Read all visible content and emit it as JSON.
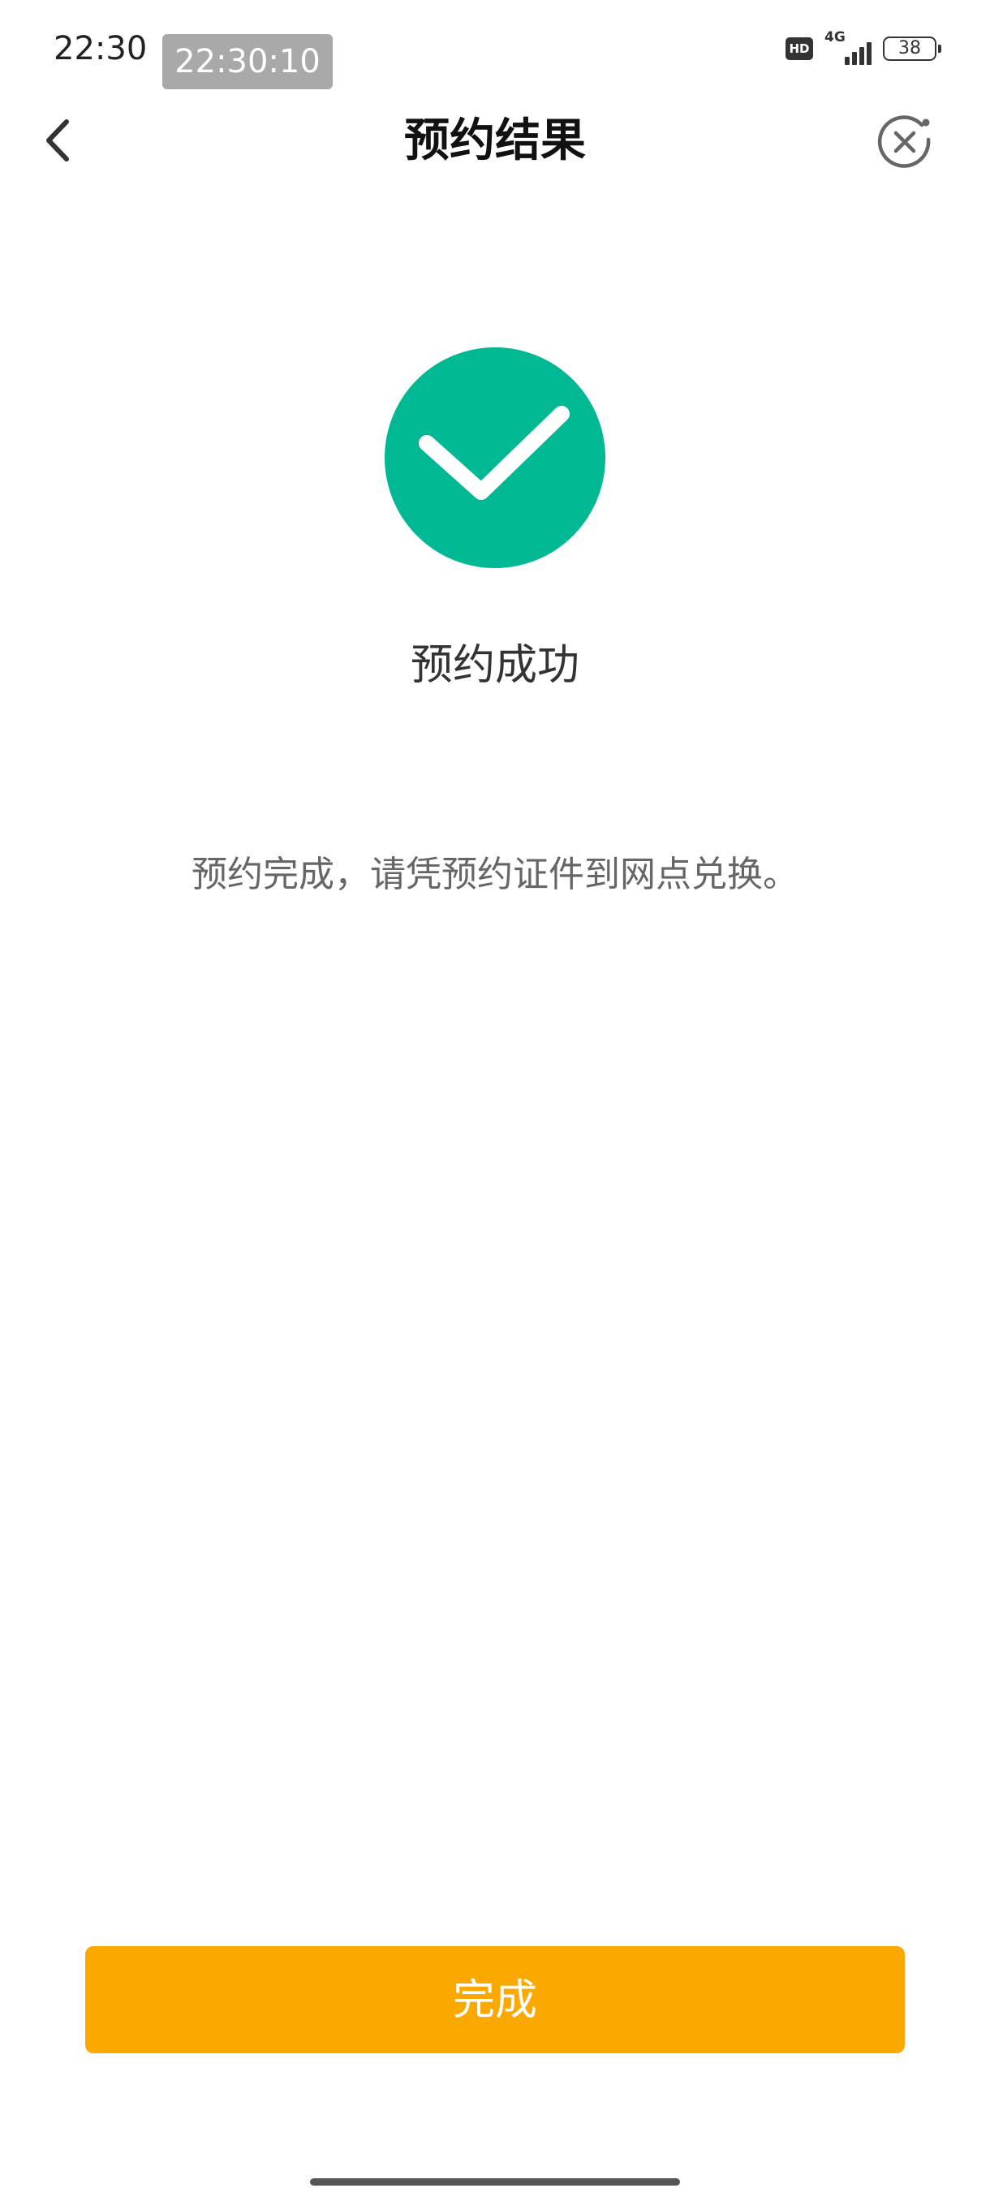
{
  "status_bar": {
    "time": "22:30",
    "clock_overlay": "22:30:10",
    "hd_badge": "HD",
    "network": "4G",
    "battery": "38"
  },
  "nav": {
    "title": "预约结果",
    "back_icon": "chevron-left-icon",
    "close_icon": "close-circle-icon"
  },
  "result": {
    "icon": "check-circle-icon",
    "icon_color": "#00b894",
    "title": "预约成功",
    "description": "预约完成，请凭预约证件到网点兑换。"
  },
  "footer": {
    "done_label": "完成",
    "button_color": "#fba800"
  }
}
